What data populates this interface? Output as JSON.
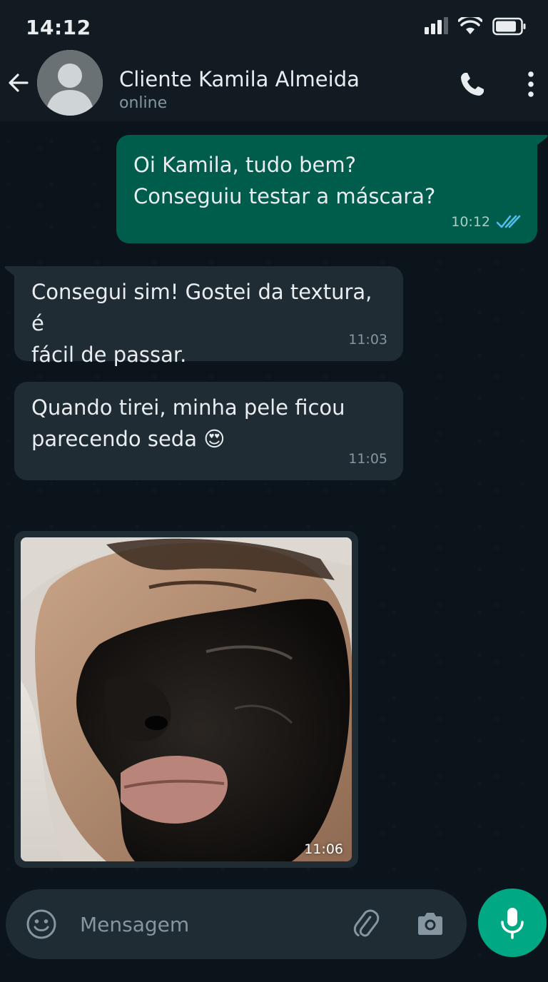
{
  "status_bar": {
    "time": "14:12",
    "icons": [
      "signal-icon",
      "wifi-icon",
      "battery-icon"
    ]
  },
  "header": {
    "contact_name": "Cliente Kamila Almeida",
    "contact_status": "online",
    "icons": [
      "back-arrow-icon",
      "avatar-placeholder-icon",
      "phone-icon",
      "more-vertical-icon"
    ]
  },
  "messages": [
    {
      "direction": "outgoing",
      "text": "Oi Kamila, tudo bem?\nConseguiu testar a máscara?",
      "time": "10:12",
      "read_receipt": "double-check-read-icon"
    },
    {
      "direction": "incoming",
      "text": "Consegui sim! Gostei da textura, é\nfácil de passar.",
      "time": "11:03"
    },
    {
      "direction": "incoming",
      "text": "Quando tirei, minha pele ficou\nparecendo seda 😍",
      "time": "11:05"
    },
    {
      "direction": "incoming",
      "type": "image",
      "image_alt": "photo-face-black-mask",
      "time": "11:06"
    }
  ],
  "input_bar": {
    "placeholder": "Mensagem",
    "icons": [
      "emoji-icon",
      "attach-clip-icon",
      "camera-icon",
      "mic-icon"
    ]
  },
  "colors": {
    "background": "#0b141a",
    "header": "#111b21",
    "outgoing_bubble": "#005c4b",
    "incoming_bubble": "#202c33",
    "accent_green": "#00a884",
    "read_check_blue": "#53bdeb",
    "secondary_text": "#8696a0"
  }
}
